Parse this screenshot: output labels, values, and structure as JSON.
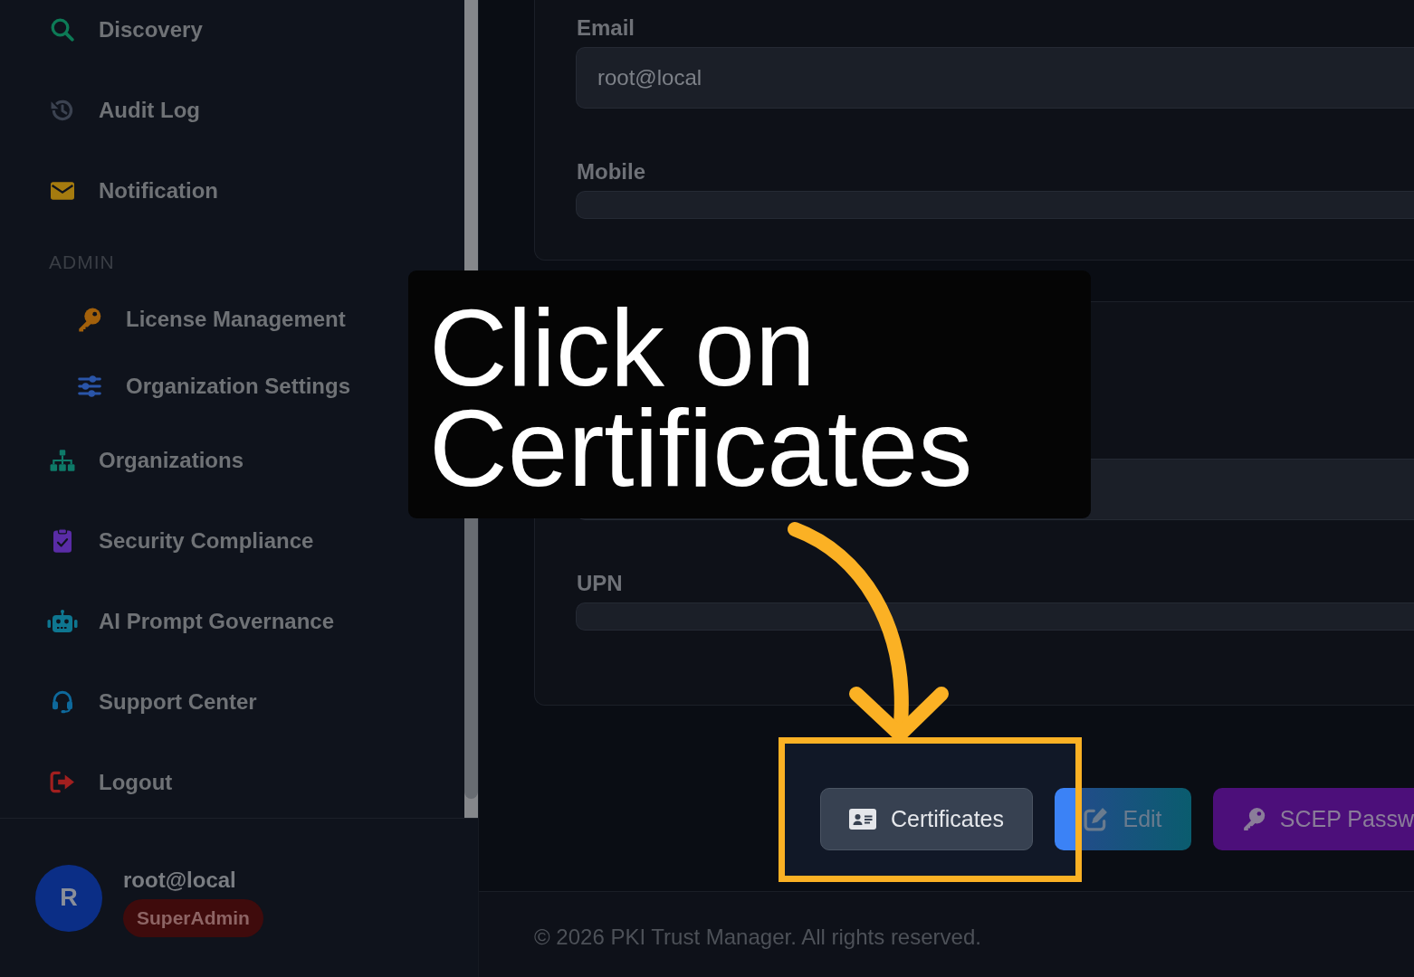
{
  "sidebar": {
    "nav": [
      {
        "kind": "item",
        "label": "Discovery",
        "color": "#0d7a56"
      },
      {
        "kind": "item",
        "label": "Audit Log",
        "color": "#3b4250"
      },
      {
        "kind": "item",
        "label": "Notification",
        "color": "#a57b0f"
      },
      {
        "kind": "section",
        "label": "ADMIN"
      },
      {
        "kind": "subitem",
        "label": "License Management",
        "color": "#a2600b"
      },
      {
        "kind": "subitem",
        "label": "Organization Settings",
        "color": "#2a55a8"
      },
      {
        "kind": "item",
        "label": "Organizations",
        "color": "#0e7a68"
      },
      {
        "kind": "item",
        "label": "Security Compliance",
        "color": "#5a2ca6"
      },
      {
        "kind": "item",
        "label": "AI Prompt Governance",
        "color": "#0e7690"
      },
      {
        "kind": "item",
        "label": "Support Center",
        "color": "#0e699c"
      },
      {
        "kind": "item",
        "label": "Logout",
        "color": "#a11f1f"
      }
    ],
    "user": {
      "initial": "R",
      "name": "root@local",
      "role": "SuperAdmin"
    }
  },
  "profile": {
    "cards": [
      {
        "fields": [
          {
            "label": "Email",
            "kind": "filled",
            "value": "root@local"
          },
          {
            "label": "Mobile",
            "kind": "empty"
          }
        ]
      },
      {
        "fields": [
          {
            "kind": "filled"
          },
          {
            "label": "UPN",
            "kind": "empty"
          }
        ]
      }
    ],
    "buttons": [
      {
        "label": "Certificates",
        "kind": "secondary",
        "highlighted": true
      },
      {
        "label": "Edit",
        "kind": "gradient",
        "highlighted": false
      },
      {
        "label": "SCEP Passw",
        "kind": "purple",
        "highlighted": false
      }
    ]
  },
  "footer": {
    "text": "© 2026 PKI Trust Manager. All rights reserved."
  },
  "callout": {
    "text": "Click on Certificates"
  }
}
